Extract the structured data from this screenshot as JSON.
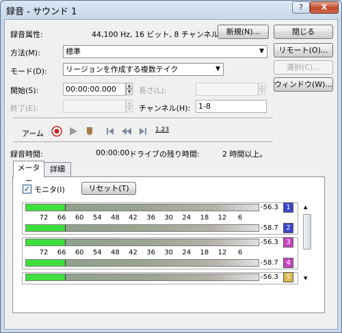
{
  "window": {
    "title": "録音 - サウンド 1",
    "help_label": "?",
    "close_label": "X"
  },
  "format": {
    "label": "録音属性:",
    "value": "44,100 Hz, 16 ビット, 8 チャンネル"
  },
  "buttons": {
    "new": "新規(N)...",
    "close": "閉じる",
    "remote": "リモート(O)...",
    "select": "選択(C)...",
    "window": "ウィンドウ(W)..."
  },
  "method": {
    "label": "方法(M):",
    "value": "標準"
  },
  "mode": {
    "label": "モード(D):",
    "value": "リージョンを作成する複数テイク"
  },
  "start": {
    "label": "開始(S):",
    "value": "00:00:00.000"
  },
  "length": {
    "label": "長さ(L):",
    "value": ""
  },
  "end": {
    "label": "終了(E):",
    "value": ""
  },
  "channel": {
    "label": "チャンネル(H):",
    "value": "1-8"
  },
  "transport": {
    "arm_label": "アーム",
    "icons": [
      "record-icon",
      "play-icon",
      "marker-icon",
      "go-to-start-icon",
      "rewind-icon",
      "go-to-end-icon",
      "counter-icon"
    ],
    "counter_text": "1.23"
  },
  "status": {
    "record_time_label": "録音時間:",
    "record_time_value": "00:00:00",
    "drive_label": "ドライブの残り時間:",
    "drive_value": "2 時間以上。"
  },
  "tabs": [
    "メーター",
    "詳細"
  ],
  "meters": {
    "monitor_label": "モニタ(I)",
    "monitor_checked": true,
    "reset_label": "リセット(T)",
    "scale": [
      "72",
      "66",
      "60",
      "54",
      "48",
      "42",
      "36",
      "30",
      "24",
      "18",
      "12",
      "6"
    ],
    "channels": [
      {
        "num": "1",
        "db": "-56.3",
        "color": "#3a46c8",
        "level": 0.17
      },
      {
        "num": "2",
        "db": "-58.7",
        "color": "#3a46c8",
        "level": 0.17
      },
      {
        "num": "3",
        "db": "-56.3",
        "color": "#c845c0",
        "level": 0.17
      },
      {
        "num": "4",
        "db": "-58.7",
        "color": "#c845c0",
        "level": 0.17
      },
      {
        "num": "5",
        "db": "-56.3",
        "color": "#d8b84a",
        "level": 0.17
      }
    ]
  }
}
